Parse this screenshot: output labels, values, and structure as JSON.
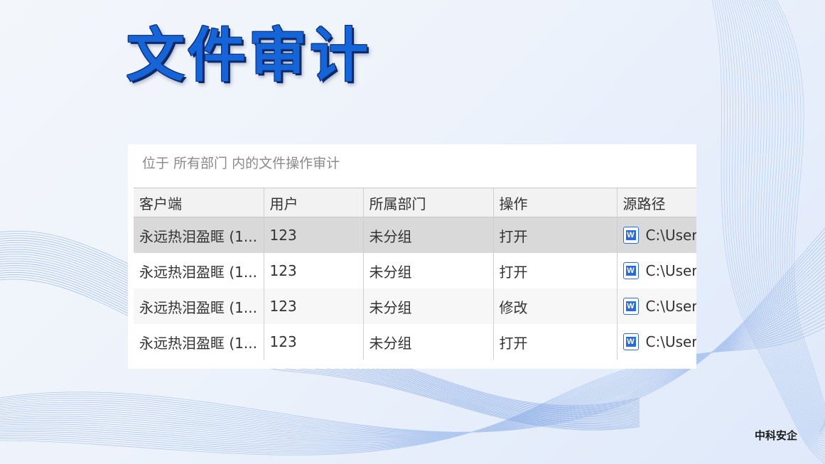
{
  "slide": {
    "title": "文件审计",
    "brand": "中科安企"
  },
  "audit_panel": {
    "caption": "位于 所有部门 内的文件操作审计",
    "columns": [
      "客户端",
      "用户",
      "所属部门",
      "操作",
      "源路径"
    ],
    "rows": [
      {
        "client": "永远热泪盈眶 (1...",
        "user": "123",
        "department": "未分组",
        "operation": "打开",
        "file_icon": "word-document-icon",
        "source_path": "C:\\User"
      },
      {
        "client": "永远热泪盈眶 (1...",
        "user": "123",
        "department": "未分组",
        "operation": "打开",
        "file_icon": "word-document-icon",
        "source_path": "C:\\User"
      },
      {
        "client": "永远热泪盈眶 (1...",
        "user": "123",
        "department": "未分组",
        "operation": "修改",
        "file_icon": "word-document-icon",
        "source_path": "C:\\User"
      },
      {
        "client": "永远热泪盈眶 (1...",
        "user": "123",
        "department": "未分组",
        "operation": "打开",
        "file_icon": "word-document-icon",
        "source_path": "C:\\User"
      }
    ],
    "selected_row": 0
  },
  "colors": {
    "title": "#1565d8",
    "title_outline": "#0c2a6b",
    "wave_lines": "#6f97de",
    "selected_row": "#d9d9d9",
    "word_icon": "#2b6bd6"
  }
}
